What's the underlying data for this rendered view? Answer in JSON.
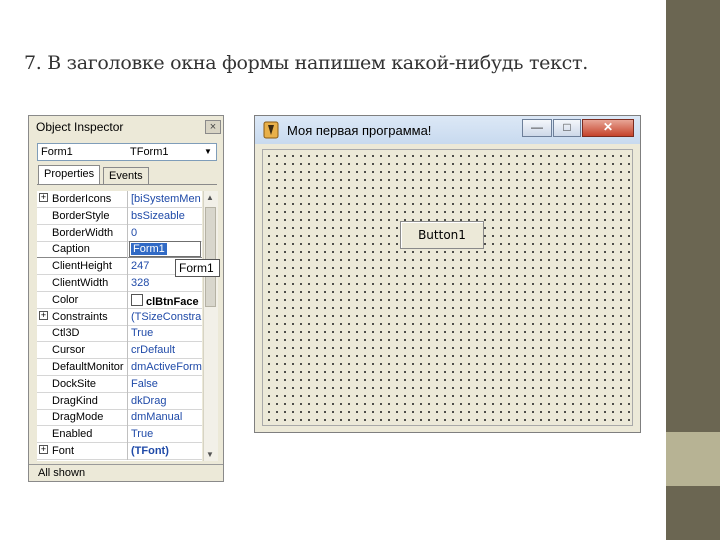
{
  "slide": {
    "title": "7. В заголовке окна формы напишем какой-нибудь текст."
  },
  "colors": {
    "accent_dark": "#6b6652",
    "accent_light": "#b7b394",
    "selection": "#316ac5"
  },
  "object_inspector": {
    "title": "Object Inspector",
    "close_glyph": "×",
    "component": {
      "name": "Form1",
      "type": "TForm1"
    },
    "tabs": [
      {
        "label": "Properties"
      },
      {
        "label": "Events"
      }
    ],
    "selected_property": "Caption",
    "tooltip": "Form1",
    "status": "All shown",
    "properties": [
      {
        "name": "BorderIcons",
        "value": "[biSystemMen",
        "expandable": true
      },
      {
        "name": "BorderStyle",
        "value": "bsSizeable"
      },
      {
        "name": "BorderWidth",
        "value": "0"
      },
      {
        "name": "Caption",
        "value": "Form1",
        "selected": true
      },
      {
        "name": "ClientHeight",
        "value": "247"
      },
      {
        "name": "ClientWidth",
        "value": "328"
      },
      {
        "name": "Color",
        "value": "clBtnFace"
      },
      {
        "name": "Constraints",
        "value": "(TSizeConstra",
        "expandable": true
      },
      {
        "name": "Ctl3D",
        "value": "True"
      },
      {
        "name": "Cursor",
        "value": "crDefault"
      },
      {
        "name": "DefaultMonitor",
        "value": "dmActiveForm"
      },
      {
        "name": "DockSite",
        "value": "False"
      },
      {
        "name": "DragKind",
        "value": "dkDrag"
      },
      {
        "name": "DragMode",
        "value": "dmManual"
      },
      {
        "name": "Enabled",
        "value": "True"
      },
      {
        "name": "Font",
        "value": "(TFont)",
        "expandable": true
      }
    ]
  },
  "form_window": {
    "title": "Моя первая программа!",
    "minimize_glyph": "—",
    "maximize_glyph": "□",
    "close_glyph": "✕",
    "button": {
      "label": "Button1"
    }
  }
}
